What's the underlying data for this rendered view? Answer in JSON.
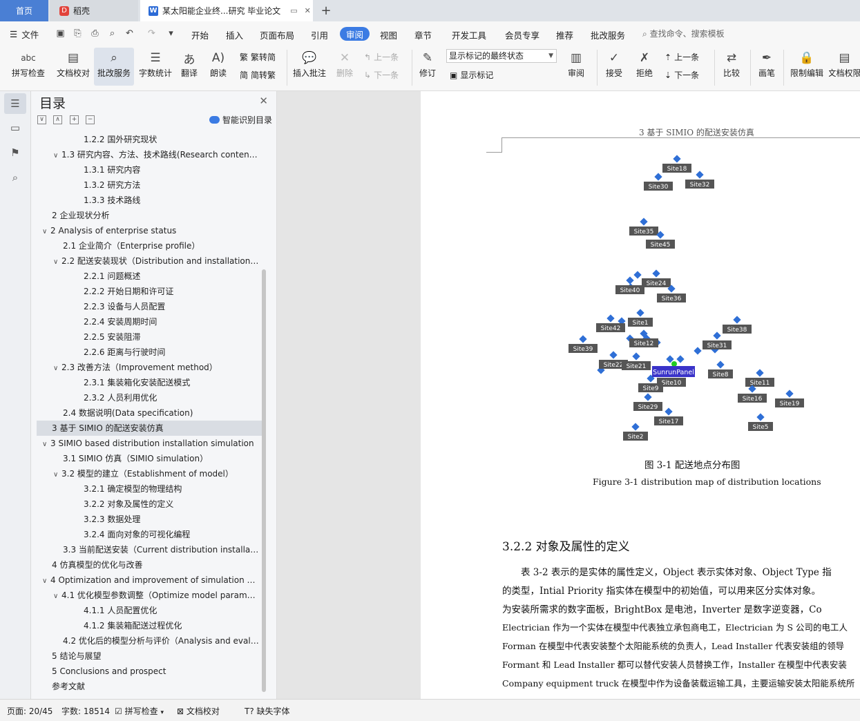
{
  "tabs": {
    "home": "首页",
    "daoke": "稻壳",
    "document": "某太阳能企业终...研究 毕业论文"
  },
  "menu": {
    "file": "文件",
    "items": [
      "开始",
      "插入",
      "页面布局",
      "引用",
      "审阅",
      "视图",
      "章节",
      "开发工具",
      "会员专享",
      "推荐",
      "批改服务"
    ],
    "active": "审阅",
    "search_placeholder": "查找命令、搜索模板"
  },
  "ribbon": {
    "spell_check": "拼写检查",
    "doc_proof": "文档校对",
    "correction_service": "批改服务",
    "word_count": "字数统计",
    "translate": "翻译",
    "read_aloud": "朗读",
    "trad_to_simp": "繁转简",
    "simp_to_trad": "简转繁",
    "insert_comment": "插入批注",
    "delete": "删除",
    "prev_comment": "上一条",
    "next_comment": "下一条",
    "track_changes": "修订",
    "markup_state": "显示标记的最终状态",
    "show_markup": "显示标记",
    "review_pane": "审阅",
    "accept": "接受",
    "reject": "拒绝",
    "prev_change": "上一条",
    "next_change": "下一条",
    "compare": "比较",
    "ink": "画笔",
    "restrict_edit": "限制编辑",
    "doc_permission": "文档权限"
  },
  "toc": {
    "title": "目录",
    "smart_label": "智能识别目录",
    "items": [
      {
        "level": 3,
        "caret": "",
        "text": "1.2.2  国外研究现状"
      },
      {
        "level": 2,
        "caret": "v",
        "text": "1.3  研究内容、方法、技术路线(Research conten…"
      },
      {
        "level": 3,
        "caret": "",
        "text": "1.3.1  研究内容"
      },
      {
        "level": 3,
        "caret": "",
        "text": "1.3.2  研究方法"
      },
      {
        "level": 3,
        "caret": "",
        "text": "1.3.3  技术路线"
      },
      {
        "level": 1,
        "caret": "",
        "text": "2  企业现状分析"
      },
      {
        "level": 1,
        "caret": "v",
        "text": "2 Analysis of enterprise status"
      },
      {
        "level": 2,
        "caret": "",
        "text": "2.1  企业简介（Enterprise profile）"
      },
      {
        "level": 2,
        "caret": "v",
        "text": "2.2  配送安装现状（Distribution and installation…"
      },
      {
        "level": 3,
        "caret": "",
        "text": "2.2.1  问题概述"
      },
      {
        "level": 3,
        "caret": "",
        "text": "2.2.2  开始日期和许可证"
      },
      {
        "level": 3,
        "caret": "",
        "text": "2.2.3  设备与人员配置"
      },
      {
        "level": 3,
        "caret": "",
        "text": "2.2.4  安装周期时间"
      },
      {
        "level": 3,
        "caret": "",
        "text": "2.2.5  安装阻滞"
      },
      {
        "level": 3,
        "caret": "",
        "text": "2.2.6  距离与行驶时间"
      },
      {
        "level": 2,
        "caret": "v",
        "text": "2.3  改善方法（Improvement method）"
      },
      {
        "level": 3,
        "caret": "",
        "text": "2.3.1  集装箱化安装配送模式"
      },
      {
        "level": 3,
        "caret": "",
        "text": "2.3.2  人员利用优化"
      },
      {
        "level": 2,
        "caret": "",
        "text": "2.4  数据说明(Data specification)"
      },
      {
        "level": 1,
        "caret": "",
        "text": "3  基于 SIMIO 的配送安装仿真",
        "selected": true
      },
      {
        "level": 1,
        "caret": "v",
        "text": "3 SIMIO based distribution installation simulation"
      },
      {
        "level": 2,
        "caret": "",
        "text": "3.1 SIMIO 仿真（SIMIO simulation）"
      },
      {
        "level": 2,
        "caret": "v",
        "text": "3.2  模型的建立（Establishment of model）"
      },
      {
        "level": 3,
        "caret": "",
        "text": "3.2.1  确定模型的物理结构"
      },
      {
        "level": 3,
        "caret": "",
        "text": "3.2.2  对象及属性的定义"
      },
      {
        "level": 3,
        "caret": "",
        "text": "3.2.3  数据处理"
      },
      {
        "level": 3,
        "caret": "",
        "text": "3.2.4  面向对象的可视化编程"
      },
      {
        "level": 2,
        "caret": "",
        "text": "3.3  当前配送安装（Current distribution installa…"
      },
      {
        "level": 1,
        "caret": "",
        "text": "4  仿真模型的优化与改善"
      },
      {
        "level": 1,
        "caret": "v",
        "text": "4 Optimization and improvement of simulation …"
      },
      {
        "level": 2,
        "caret": "v",
        "text": "4.1  优化模型参数调整（Optimize model param…"
      },
      {
        "level": 3,
        "caret": "",
        "text": "4.1.1  人员配置优化"
      },
      {
        "level": 3,
        "caret": "",
        "text": "4.1.2  集装箱配送过程优化"
      },
      {
        "level": 2,
        "caret": "",
        "text": "4.2  优化后的模型分析与评价（Analysis and eval…"
      },
      {
        "level": 1,
        "caret": "",
        "text": "5  结论与展望"
      },
      {
        "level": 1,
        "caret": "",
        "text": "5 Conclusions and prospect"
      },
      {
        "level": 1,
        "caret": "",
        "text": "参考文献"
      }
    ]
  },
  "document": {
    "running_head": "3 基于 SIMIO 的配送安装仿真",
    "figure": {
      "caption_cn": "图 3-1  配送地点分布图",
      "caption_en": "Figure 3-1 distribution map of distribution locations",
      "center_label": "SunrunPanel",
      "sites": [
        "Site18",
        "Site30",
        "Site32",
        "Site35",
        "Site45",
        "Site24",
        "Site40",
        "Site36",
        "Site1",
        "Site42",
        "Site38",
        "Site12",
        "Site31",
        "Site39",
        "Site22",
        "Site21",
        "Site8",
        "Site10",
        "Site9",
        "Site11",
        "Site16",
        "Site19",
        "Site29",
        "Site17",
        "Site5",
        "Site2"
      ]
    },
    "section_heading": "3.2.2  对象及属性的定义",
    "paragraph_lines": [
      "　　表 3-2 表示的是实体的属性定义，Object 表示实体对象、Object Type 指",
      "的类型，Intial Priority 指实体在模型中的初始值，可以用来区分实体对象。",
      "为安装所需求的数字面板，BrightBox 是电池，Inverter 是数字逆变器，Co",
      "Electrician 作为一个实体在模型中代表独立承包商电工，Electrician 为 S 公司的电工人",
      "Forman 在模型中代表安装整个太阳能系统的负责人，Lead Installer 代表安装组的领导",
      "Formant 和 Lead Installer 都可以替代安装人员替换工作，Installer 在模型中代表安装",
      "Company equipment truck 在模型中作为设备装载运输工具，主要运输安装太阳能系统所"
    ]
  },
  "status": {
    "page": "页面: 20/45",
    "words": "字数: 18514",
    "spell": "拼写检查",
    "proof": "文档校对",
    "missing_font": "缺失字体"
  },
  "colors": {
    "accent": "#3b7be3",
    "home_tab": "#4a7fd4",
    "node": "#2f6fd6",
    "label_bg": "#555555"
  }
}
